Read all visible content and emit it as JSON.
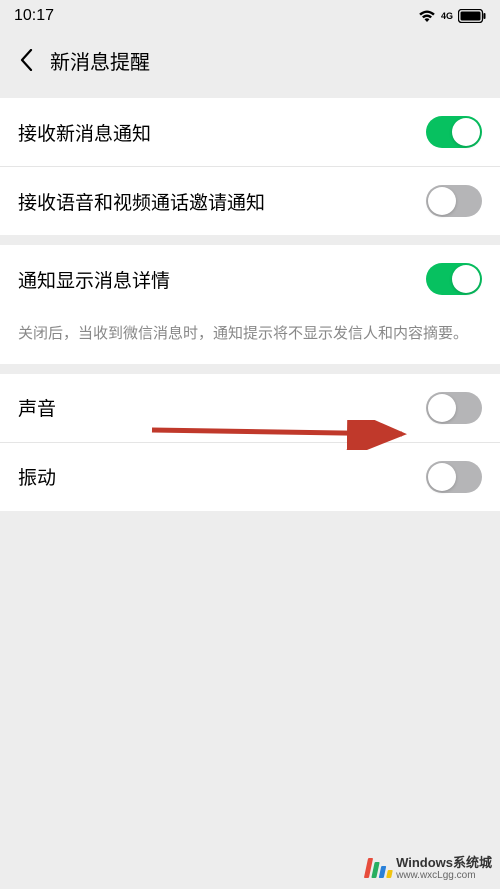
{
  "status": {
    "time": "10:17",
    "network_label": "4G"
  },
  "nav": {
    "title": "新消息提醒"
  },
  "settings": {
    "receive_new_msg": {
      "label": "接收新消息通知",
      "checked": true
    },
    "receive_voice_video": {
      "label": "接收语音和视频通话邀请通知",
      "checked": false
    },
    "show_detail": {
      "label": "通知显示消息详情",
      "checked": true,
      "desc": "关闭后，当收到微信消息时，通知提示将不显示发信人和内容摘要。"
    },
    "sound": {
      "label": "声音",
      "checked": false
    },
    "vibrate": {
      "label": "振动",
      "checked": false
    }
  },
  "watermark": {
    "title": "Windows系统城",
    "url": "www.wxcLgg.com"
  }
}
